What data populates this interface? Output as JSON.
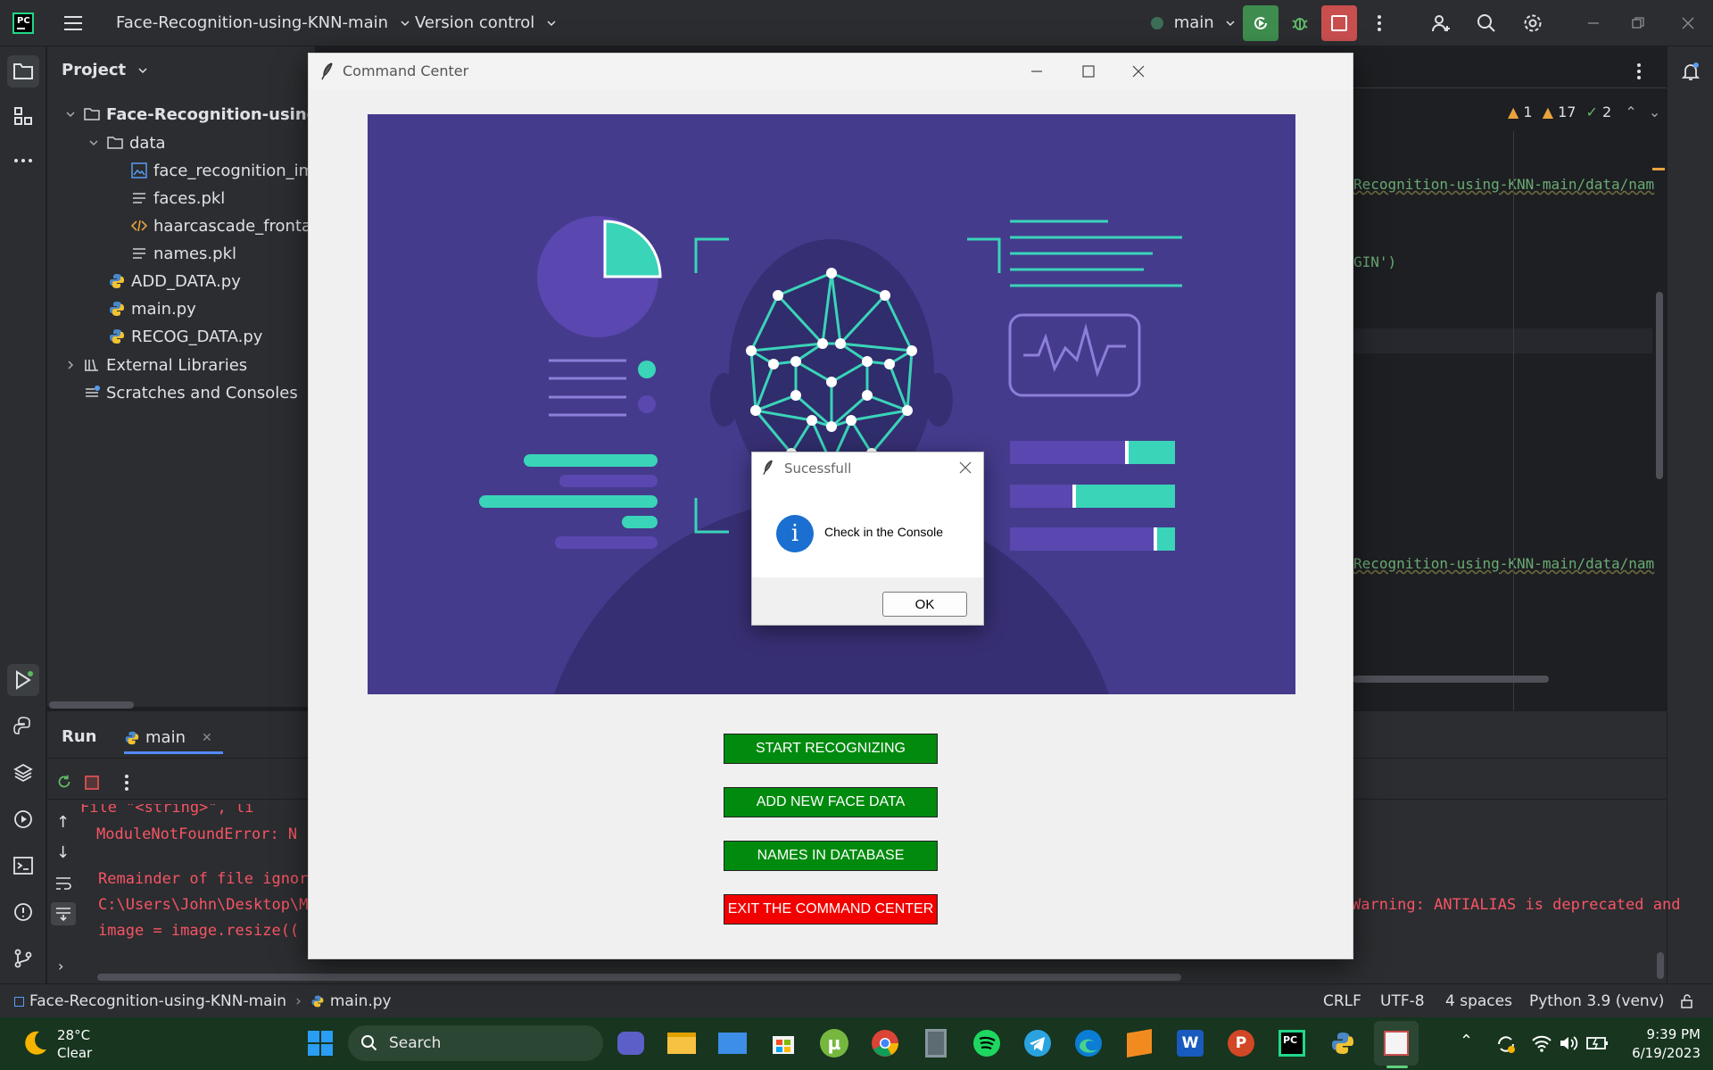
{
  "ide": {
    "project_name": "Face-Recognition-using-KNN-main",
    "version_control": "Version control",
    "branch": "main"
  },
  "project_panel": {
    "title": "Project",
    "tree": [
      {
        "label": "Face-Recognition-using-",
        "icon": "folder-icon"
      },
      {
        "label": "data",
        "icon": "folder-icon"
      },
      {
        "label": "face_recognition_imag",
        "icon": "image-file-icon"
      },
      {
        "label": "faces.pkl",
        "icon": "text-file-icon"
      },
      {
        "label": "haarcascade_frontalfa",
        "icon": "xml-file-icon"
      },
      {
        "label": "names.pkl",
        "icon": "text-file-icon"
      },
      {
        "label": "ADD_DATA.py",
        "icon": "python-file-icon"
      },
      {
        "label": "main.py",
        "icon": "python-file-icon"
      },
      {
        "label": "RECOG_DATA.py",
        "icon": "python-file-icon"
      },
      {
        "label": "External Libraries",
        "icon": "library-icon"
      },
      {
        "label": "Scratches and Consoles",
        "icon": "scratches-icon"
      }
    ]
  },
  "editor": {
    "inspections": {
      "errors": "1",
      "warnings": "17",
      "ok": "2"
    },
    "lines": [
      "Recognition-using-KNN-main/data/nam",
      "GIN')",
      "Recognition-using-KNN-main/data/nam"
    ]
  },
  "run_panel": {
    "tab_run": "Run",
    "tab_main": "main",
    "console": [
      "  File \"<string>\", li",
      "  ModuleNotFoundError: N",
      "Remainder of file ignore",
      "C:\\Users\\John\\Desktop\\ML",
      "  image = image.resize((",
      "Warning: ANTIALIAS is deprecated and"
    ]
  },
  "status_bar": {
    "breadcrumb_project": "Face-Recognition-using-KNN-main",
    "breadcrumb_file": "main.py",
    "line_sep": "CRLF",
    "encoding": "UTF-8",
    "indent": "4 spaces",
    "interpreter": "Python 3.9 (venv)"
  },
  "command_center": {
    "title": "Command Center",
    "buttons": {
      "start": "START RECOGNIZING",
      "add": "ADD NEW FACE DATA",
      "names": "NAMES IN DATABASE",
      "exit": "EXIT THE COMMAND CENTER"
    },
    "colors": {
      "green": "#008a0e",
      "red": "#f20000",
      "banner": "#443b8c",
      "accent": "#3ad4b8"
    }
  },
  "dialog": {
    "title": "Sucessfull",
    "message": "Check in the Console",
    "ok": "OK"
  },
  "taskbar": {
    "weather_temp": "28°C",
    "weather_desc": "Clear",
    "search_placeholder": "Search",
    "time": "9:39 PM",
    "date": "6/19/2023"
  }
}
